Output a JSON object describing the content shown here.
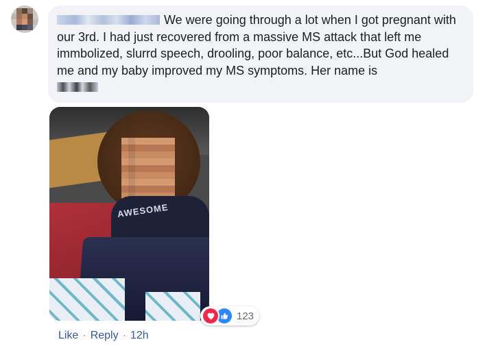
{
  "comment": {
    "author_name_redacted": true,
    "text": "We were going through a lot when I got pregnant with our 3rd. I had just recovered from a massive MS attack that left me immbolized, slurrd speech, drooling, poor balance, etc...But God healed me and my baby improved my MS symptoms. Her name is",
    "photo_shirt_text": "AWESOME"
  },
  "reactions": {
    "icons": [
      "love-icon",
      "like-icon"
    ],
    "count": "123",
    "colors": {
      "love": "#f0284a",
      "like": "#2d88ff"
    }
  },
  "actions": {
    "like_label": "Like",
    "reply_label": "Reply",
    "time": "12h",
    "separator": "·",
    "link_color": "#385898"
  },
  "bubble": {
    "background": "#f2f3f5"
  }
}
